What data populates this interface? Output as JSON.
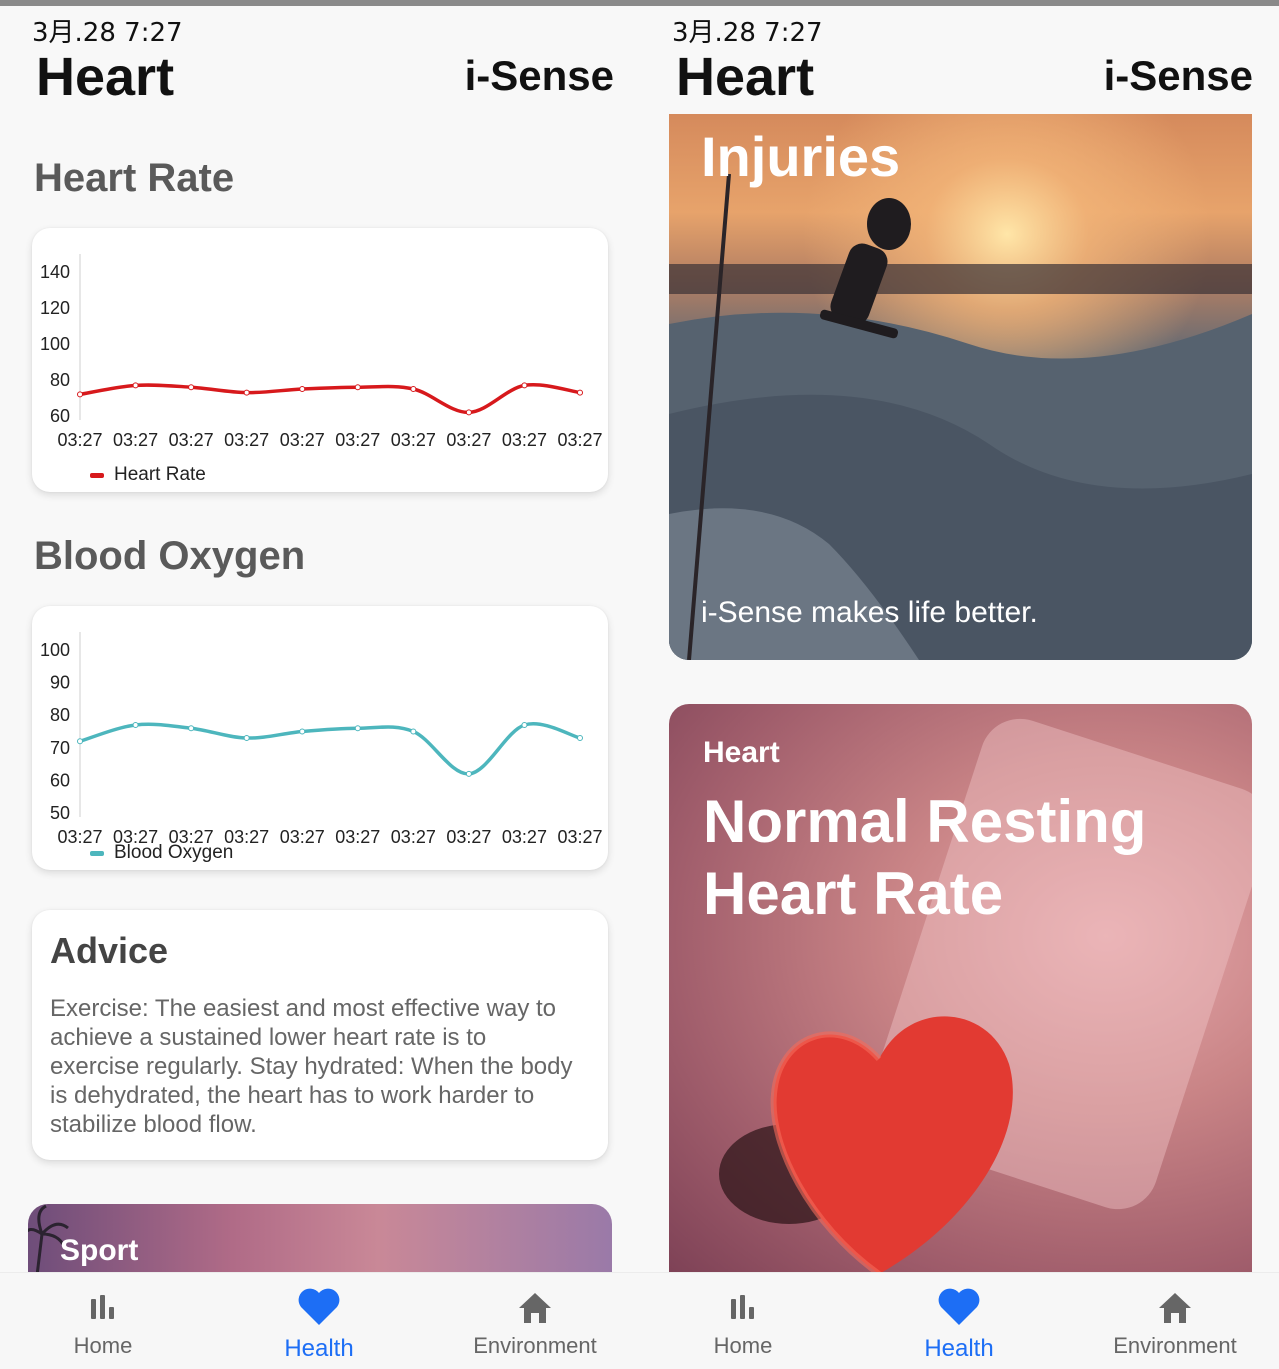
{
  "status_time": "3月.28 7:27",
  "app_title": "Heart",
  "brand": "i-Sense",
  "colors": {
    "heart_rate": "#d7191c",
    "blood_oxygen": "#4db6bd",
    "nav_active": "#1d6ef5",
    "nav_inactive": "#666666"
  },
  "heart_rate_section": {
    "title": "Heart Rate"
  },
  "blood_oxygen_section": {
    "title": "Blood Oxygen"
  },
  "chart_data": [
    {
      "type": "line",
      "categories": [
        "03:27",
        "03:27",
        "03:27",
        "03:27",
        "03:27",
        "03:27",
        "03:27",
        "03:27",
        "03:27",
        "03:27"
      ],
      "series": [
        {
          "name": "Heart Rate",
          "values": [
            72,
            77,
            76,
            73,
            75,
            76,
            75,
            62,
            77,
            73
          ]
        }
      ],
      "yticks": [
        140,
        120,
        100,
        80,
        60
      ],
      "ylim": [
        60,
        140
      ],
      "legend": "bottom-left",
      "grid": false
    },
    {
      "type": "line",
      "categories": [
        "03:27",
        "03:27",
        "03:27",
        "03:27",
        "03:27",
        "03:27",
        "03:27",
        "03:27",
        "03:27",
        "03:27"
      ],
      "series": [
        {
          "name": "Blood Oxygen",
          "values": [
            72,
            77,
            76,
            73,
            75,
            76,
            75,
            62,
            77,
            73
          ]
        }
      ],
      "yticks": [
        100,
        90,
        80,
        70,
        60,
        50
      ],
      "ylim": [
        50,
        100
      ],
      "legend": "bottom-left",
      "grid": false
    }
  ],
  "advice": {
    "title": "Advice",
    "text": "Exercise: The easiest and most effective way to achieve a sustained lower heart rate is to exercise regularly. Stay hydrated: When the body is dehydrated, the heart has to work harder to stabilize blood flow."
  },
  "sport_card": {
    "label": "Sport"
  },
  "injuries_card": {
    "headline": "Injuries",
    "tagline": "i-Sense makes life better."
  },
  "heart_card": {
    "kicker": "Heart",
    "headline": "Normal Resting Heart Rate"
  },
  "nav": {
    "items": [
      {
        "label": "Home",
        "icon": "bar-chart-icon"
      },
      {
        "label": "Health",
        "icon": "heart-icon"
      },
      {
        "label": "Environment",
        "icon": "house-icon"
      }
    ],
    "active": "Health"
  }
}
